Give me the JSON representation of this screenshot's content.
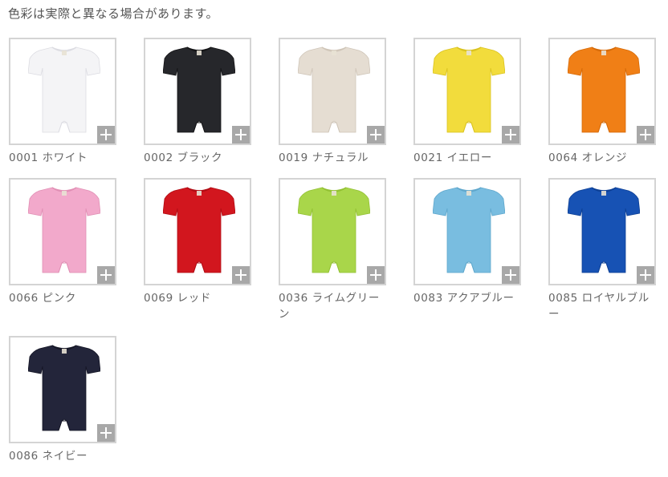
{
  "notice": "色彩は実際と異なる場合があります。",
  "swatches": [
    {
      "label": "0001 ホワイト",
      "color": "#f4f4f6",
      "shade": "#dcdce2"
    },
    {
      "label": "0002 ブラック",
      "color": "#26272b",
      "shade": "#141416"
    },
    {
      "label": "0019 ナチュラル",
      "color": "#e5ddd2",
      "shade": "#cfc5b8"
    },
    {
      "label": "0021 イエロー",
      "color": "#f2dc3c",
      "shade": "#d9c21e"
    },
    {
      "label": "0064 オレンジ",
      "color": "#f07f16",
      "shade": "#d56a08"
    },
    {
      "label": "0066 ピンク",
      "color": "#f2a9cb",
      "shade": "#e08fb4"
    },
    {
      "label": "0069 レッド",
      "color": "#d2161e",
      "shade": "#b00c14"
    },
    {
      "label": "0036 ライムグリーン",
      "color": "#a9d64a",
      "shade": "#92c033"
    },
    {
      "label": "0083 アクアブルー",
      "color": "#79bde0",
      "shade": "#5fa7cc"
    },
    {
      "label": "0085 ロイヤルブルー",
      "color": "#1752b4",
      "shade": "#0d3f94"
    },
    {
      "label": "0086 ネイビー",
      "color": "#23253a",
      "shade": "#151625"
    }
  ],
  "expand_icon": "plus-icon"
}
